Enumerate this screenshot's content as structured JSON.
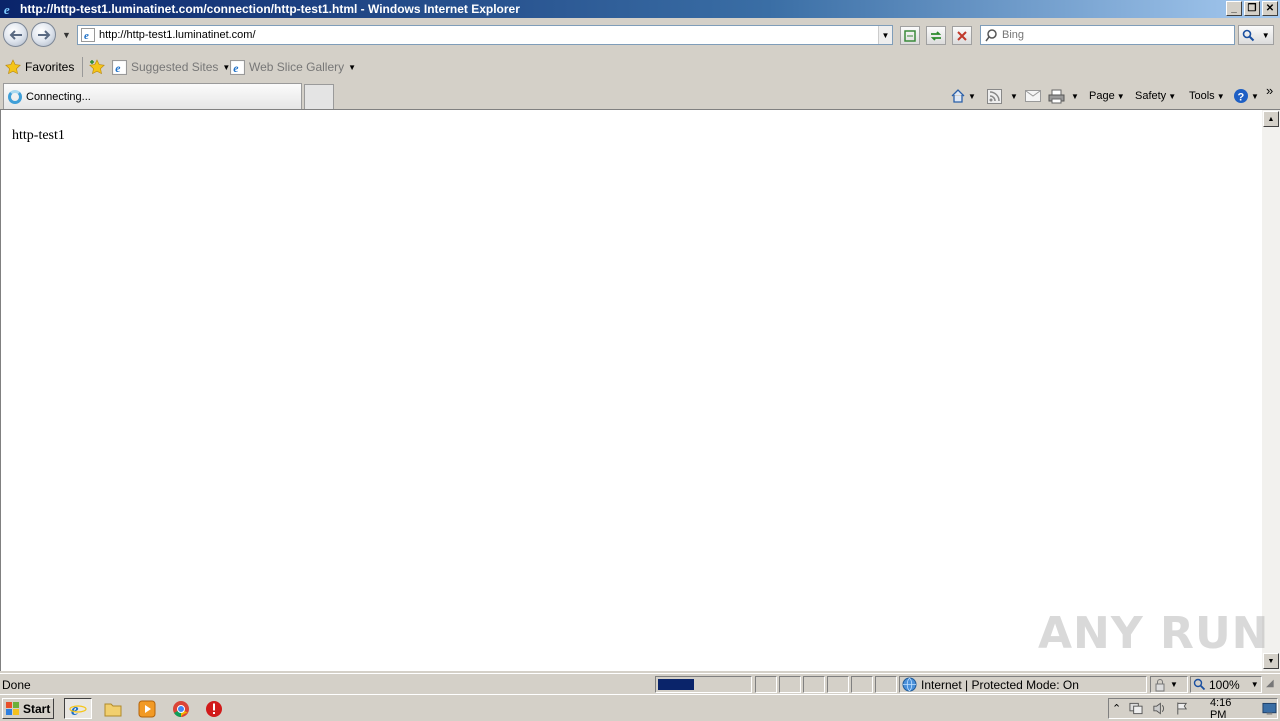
{
  "window": {
    "title": "http://http-test1.luminatinet.com/connection/http-test1.html - Windows Internet Explorer",
    "buttons": [
      "_",
      "❐",
      "✕"
    ]
  },
  "address_bar": {
    "url": "http://http-test1.luminatinet.com/"
  },
  "search": {
    "placeholder": "Bing"
  },
  "favorites_bar": {
    "favorites_label": "Favorites",
    "items": [
      {
        "label": "Suggested Sites"
      },
      {
        "label": "Web Slice Gallery"
      }
    ]
  },
  "tabs": {
    "active_label": "Connecting..."
  },
  "command_bar": {
    "page_label": "Page",
    "safety_label": "Safety",
    "tools_label": "Tools",
    "more": "»"
  },
  "content": {
    "text": "http-test1"
  },
  "watermark": "ANY RUN",
  "status_bar": {
    "status_text": "Done",
    "zone_text": "Internet | Protected Mode: On",
    "zoom": "100%"
  },
  "taskbar": {
    "start_label": "Start",
    "clock": "4:16 PM"
  }
}
